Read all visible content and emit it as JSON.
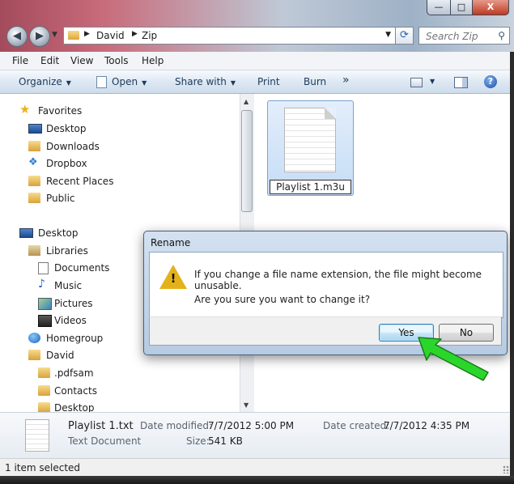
{
  "window": {
    "controls": {
      "minimize": "—",
      "maximize": "□",
      "close": "X"
    }
  },
  "address": {
    "path": [
      "David",
      "Zip"
    ]
  },
  "search": {
    "placeholder": "Search Zip"
  },
  "menu": [
    "File",
    "Edit",
    "View",
    "Tools",
    "Help"
  ],
  "commands": {
    "organize": "Organize",
    "open": "Open",
    "share": "Share with",
    "print": "Print",
    "burn": "Burn",
    "more": "»"
  },
  "nav": {
    "favorites": "Favorites",
    "fav_items": [
      "Desktop",
      "Downloads",
      "Dropbox",
      "Recent Places",
      "Public"
    ],
    "desktop": "Desktop",
    "libraries": "Libraries",
    "lib_items": [
      "Documents",
      "Music",
      "Pictures",
      "Videos"
    ],
    "homegroup": "Homegroup",
    "user": "David",
    "user_items": [
      ".pdfsam",
      "Contacts",
      "Desktop"
    ]
  },
  "content": {
    "file_name_editing": "Playlist 1.m3u"
  },
  "details": {
    "name": "Playlist 1.txt",
    "type": "Text Document",
    "modified_label": "Date modified:",
    "modified": "7/7/2012 5:00 PM",
    "created_label": "Date created:",
    "created": "7/7/2012 4:35 PM",
    "size_label": "Size:",
    "size": "541 KB"
  },
  "status": {
    "text": "1 item selected"
  },
  "dialog": {
    "title": "Rename",
    "message": "If you change a file name extension, the file might become unusable.",
    "question": "Are you sure you want to change it?",
    "yes": "Yes",
    "no": "No"
  },
  "colors": {
    "accent_arrow": "#2bd62b",
    "warning": "#e3b21b",
    "selection": "#c5dcf6"
  }
}
